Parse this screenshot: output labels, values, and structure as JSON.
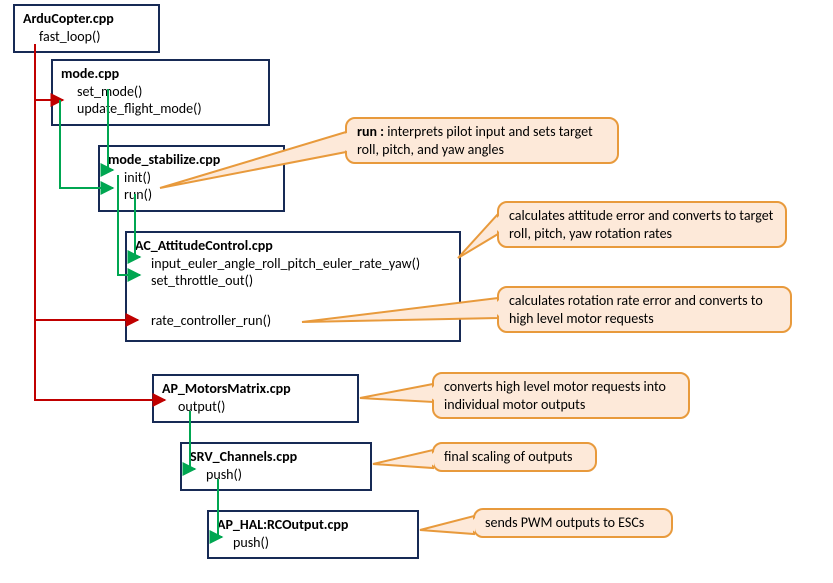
{
  "boxes": {
    "arducopter": {
      "title": "ArduCopter.cpp",
      "fn1": "fast_loop()"
    },
    "mode": {
      "title": "mode.cpp",
      "fn1": "set_mode()",
      "fn2": "update_flight_mode()"
    },
    "mode_stabilize": {
      "title": "mode_stabilize.cpp",
      "fn1": "init()",
      "fn2": "run()"
    },
    "ac_attitude": {
      "title": "AC_AttitudeControl.cpp",
      "fn1": "input_euler_angle_roll_pitch_euler_rate_yaw()",
      "fn2": "set_throttle_out()",
      "fn3": "rate_controller_run()"
    },
    "ap_motors": {
      "title": "AP_MotorsMatrix.cpp",
      "fn1": "output()"
    },
    "srv_channels": {
      "title": "SRV_Channels.cpp",
      "fn1": "push()"
    },
    "ap_hal": {
      "title": "AP_HAL:RCOutput.cpp",
      "fn1": "push()"
    }
  },
  "callouts": {
    "run": {
      "prefix": "run : ",
      "text": "interprets pilot input and sets target roll, pitch, and yaw angles"
    },
    "attitude_err": "calculates attitude error and converts to target roll, pitch, yaw rotation rates",
    "rate_err": "calculates rotation rate error and converts to high level motor requests",
    "motors": "converts high level motor requests into individual motor outputs",
    "srv": "final scaling of outputs",
    "hal": "sends PWM outputs to ESCs"
  }
}
